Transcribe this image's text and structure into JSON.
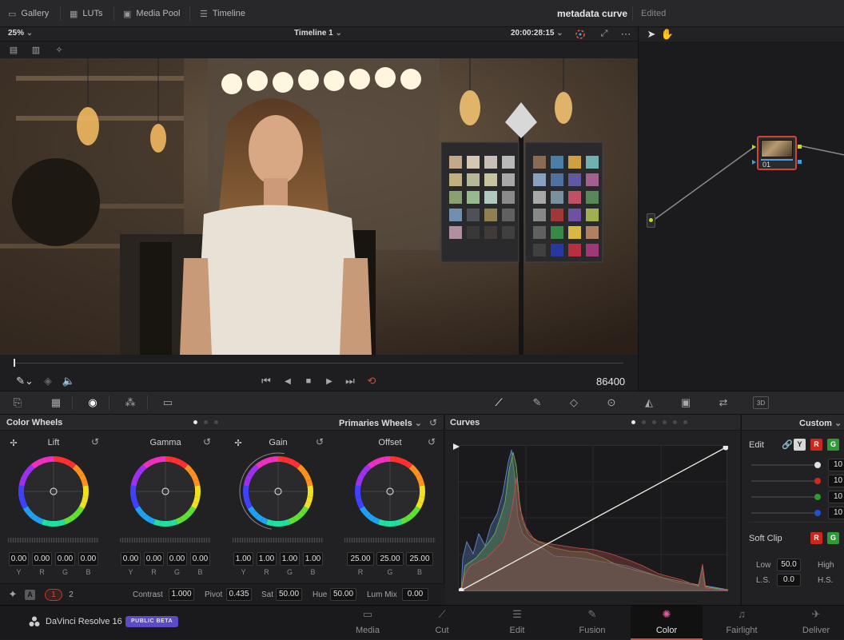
{
  "topbar": {
    "gallery": "Gallery",
    "luts": "LUTs",
    "media_pool": "Media Pool",
    "timeline": "Timeline",
    "project_title": "metadata curve",
    "project_status": "Edited"
  },
  "viewer": {
    "zoom": "25%",
    "timeline_name": "Timeline 1",
    "timecode": "20:00:28:15",
    "frame_count": "86400"
  },
  "node": {
    "label": "01"
  },
  "color_wheels": {
    "title": "Color Wheels",
    "mode": "Primaries Wheels",
    "wheels": [
      {
        "name": "Lift",
        "values": [
          "0.00",
          "0.00",
          "0.00",
          "0.00"
        ],
        "channels": [
          "Y",
          "R",
          "G",
          "B"
        ]
      },
      {
        "name": "Gamma",
        "values": [
          "0.00",
          "0.00",
          "0.00",
          "0.00"
        ],
        "channels": [
          "Y",
          "R",
          "G",
          "B"
        ]
      },
      {
        "name": "Gain",
        "values": [
          "1.00",
          "1.00",
          "1.00",
          "1.00"
        ],
        "channels": [
          "Y",
          "R",
          "G",
          "B"
        ]
      },
      {
        "name": "Offset",
        "values": [
          "25.00",
          "25.00",
          "25.00"
        ],
        "channels": [
          "R",
          "G",
          "B"
        ]
      }
    ],
    "footer": {
      "auto_label": "A",
      "page1": "1",
      "page2": "2",
      "contrast_label": "Contrast",
      "contrast_value": "1.000",
      "pivot_label": "Pivot",
      "pivot_value": "0.435",
      "sat_label": "Sat",
      "sat_value": "50.00",
      "hue_label": "Hue",
      "hue_value": "50.00",
      "lummix_label": "Lum Mix",
      "lummix_value": "0.00"
    }
  },
  "curves": {
    "title": "Curves",
    "mode": "Custom"
  },
  "edit_panel": {
    "edit_label": "Edit",
    "y": "Y",
    "r": "R",
    "g": "G",
    "values": [
      "10",
      "10",
      "10",
      "10"
    ],
    "soft_clip_label": "Soft Clip",
    "low_label": "Low",
    "low_value": "50.0",
    "high_label": "High",
    "ls_label": "L.S.",
    "ls_value": "0.0",
    "hs_label": "H.S."
  },
  "footer": {
    "app_name": "DaVinci Resolve 16",
    "badge": "PUBLIC BETA",
    "pages": [
      {
        "label": "Media",
        "icon": "media-icon"
      },
      {
        "label": "Cut",
        "icon": "cut-icon"
      },
      {
        "label": "Edit",
        "icon": "edit-icon"
      },
      {
        "label": "Fusion",
        "icon": "fusion-icon"
      },
      {
        "label": "Color",
        "icon": "color-icon"
      },
      {
        "label": "Fairlight",
        "icon": "fairlight-icon"
      },
      {
        "label": "Deliver",
        "icon": "deliver-icon"
      }
    ],
    "active_page": "Color"
  },
  "colors": {
    "accent_red": "#e0483a",
    "badge_purple": "#5b4bc4",
    "node_outline": "#d0443a"
  }
}
